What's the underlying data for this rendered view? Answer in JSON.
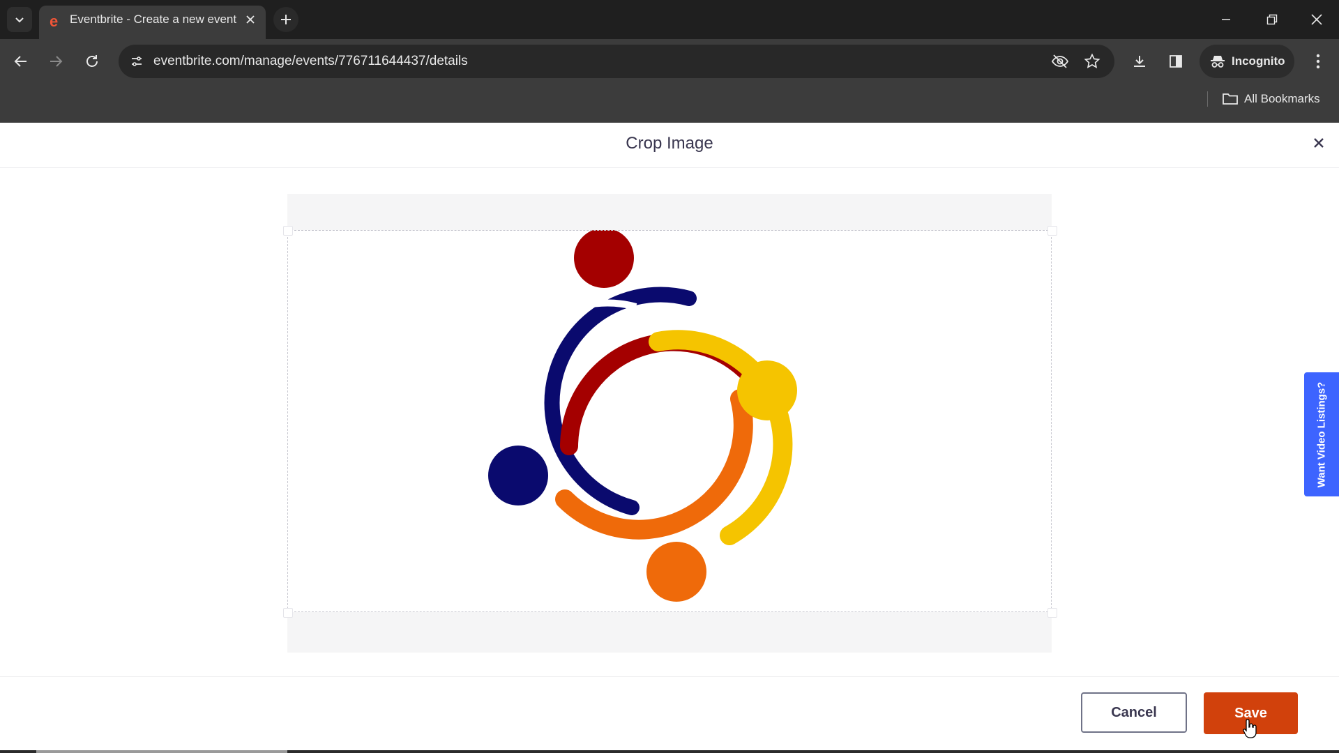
{
  "browser": {
    "tab": {
      "title": "Eventbrite - Create a new event",
      "favicon": "eventbrite-e-icon",
      "favicon_color": "#f05537"
    },
    "url": "eventbrite.com/manage/events/776711644437/details",
    "incognito_label": "Incognito",
    "bookmarks_label": "All Bookmarks",
    "icons": [
      "tab-search-icon",
      "close-icon",
      "plus-icon",
      "minimize-icon",
      "restore-icon",
      "close-window-icon",
      "back-arrow-icon",
      "forward-arrow-icon",
      "reload-icon",
      "site-settings-icon",
      "eye-off-icon",
      "star-icon",
      "download-icon",
      "side-panel-icon",
      "incognito-icon",
      "kebab-menu-icon",
      "folder-icon"
    ]
  },
  "modal": {
    "title": "Crop Image",
    "cancel_label": "Cancel",
    "save_label": "Save",
    "side_tab_label": "Want Video Listings?",
    "colors": {
      "save_button": "#d1410c",
      "side_tab": "#3d64ff",
      "title_text": "#39364f"
    }
  },
  "logo": {
    "description_icon": "community-circle-logo",
    "colors": [
      "#a40000",
      "#f5c400",
      "#ef6a0a",
      "#0a0a6e"
    ]
  }
}
